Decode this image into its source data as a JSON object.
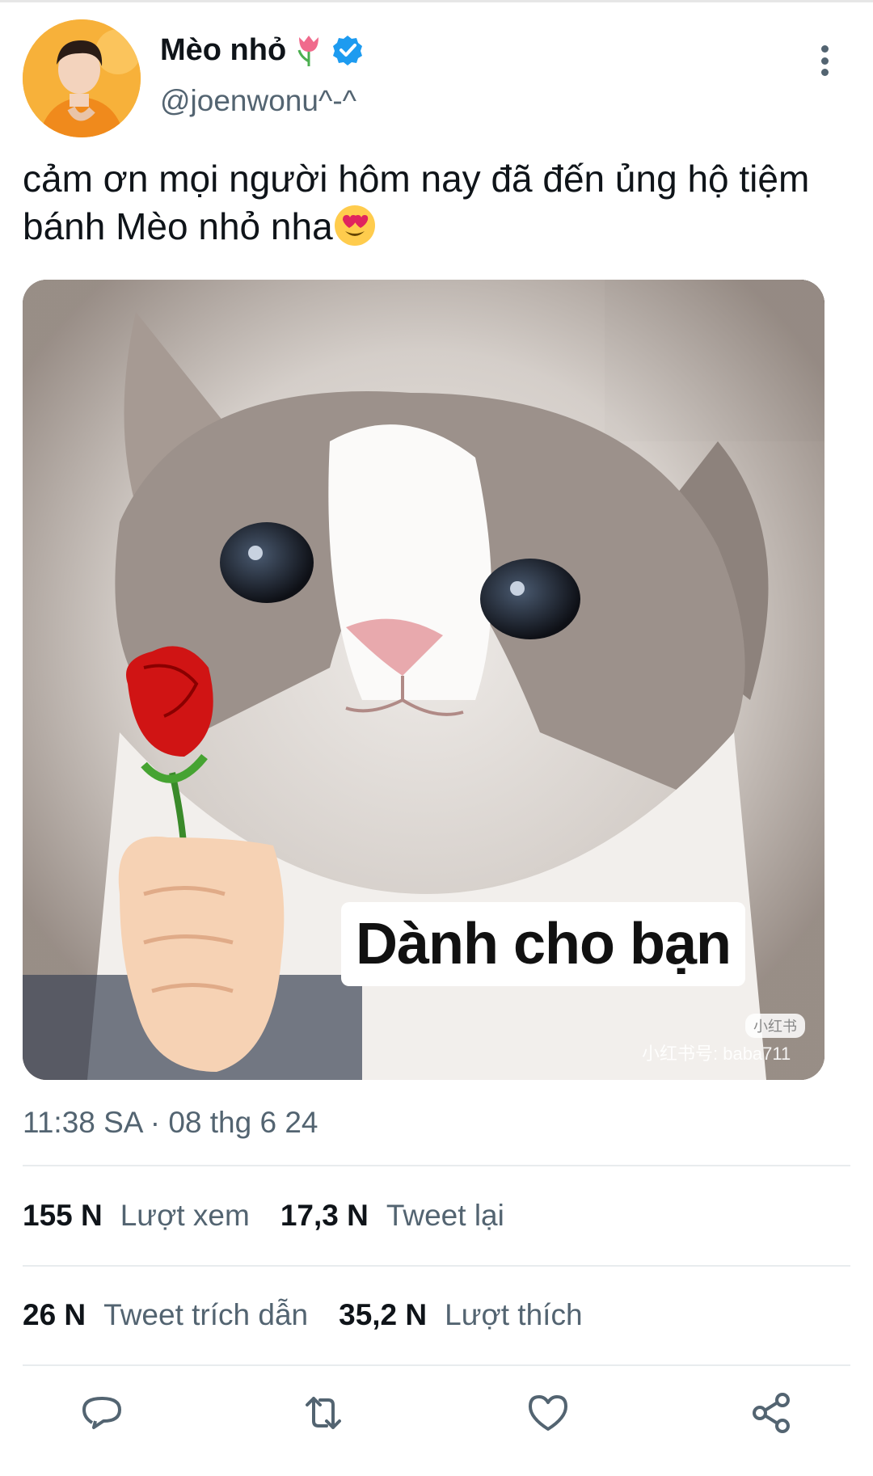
{
  "author": {
    "display_name": "Mèo nhỏ",
    "handle": "@joenwonu^-^",
    "verified": true,
    "name_emoji": "tulip-icon"
  },
  "tweet": {
    "text": "cảm ơn mọi người hôm nay đã đến ủng hộ tiệm bánh Mèo nhỏ nha",
    "text_emoji": "heart-eyes-icon"
  },
  "media": {
    "caption": "Dành cho bạn",
    "watermark_badge": "小红书",
    "watermark_text": "小红书号: baba711"
  },
  "timestamp": "11:38 SA · 08 thg 6 24",
  "stats": {
    "views_count": "155 N",
    "views_label": "Lượt xem",
    "retweets_count": "17,3 N",
    "retweets_label": "Tweet lại",
    "quotes_count": "26 N",
    "quotes_label": "Tweet trích dẫn",
    "likes_count": "35,2 N",
    "likes_label": "Lượt thích"
  },
  "actions": [
    "reply-icon",
    "retweet-icon",
    "like-icon",
    "share-icon"
  ],
  "colors": {
    "verified": "#1d9bf0",
    "secondary_text": "#536471",
    "divider": "#e8ecee",
    "avatar_bg": "#f5a623"
  }
}
